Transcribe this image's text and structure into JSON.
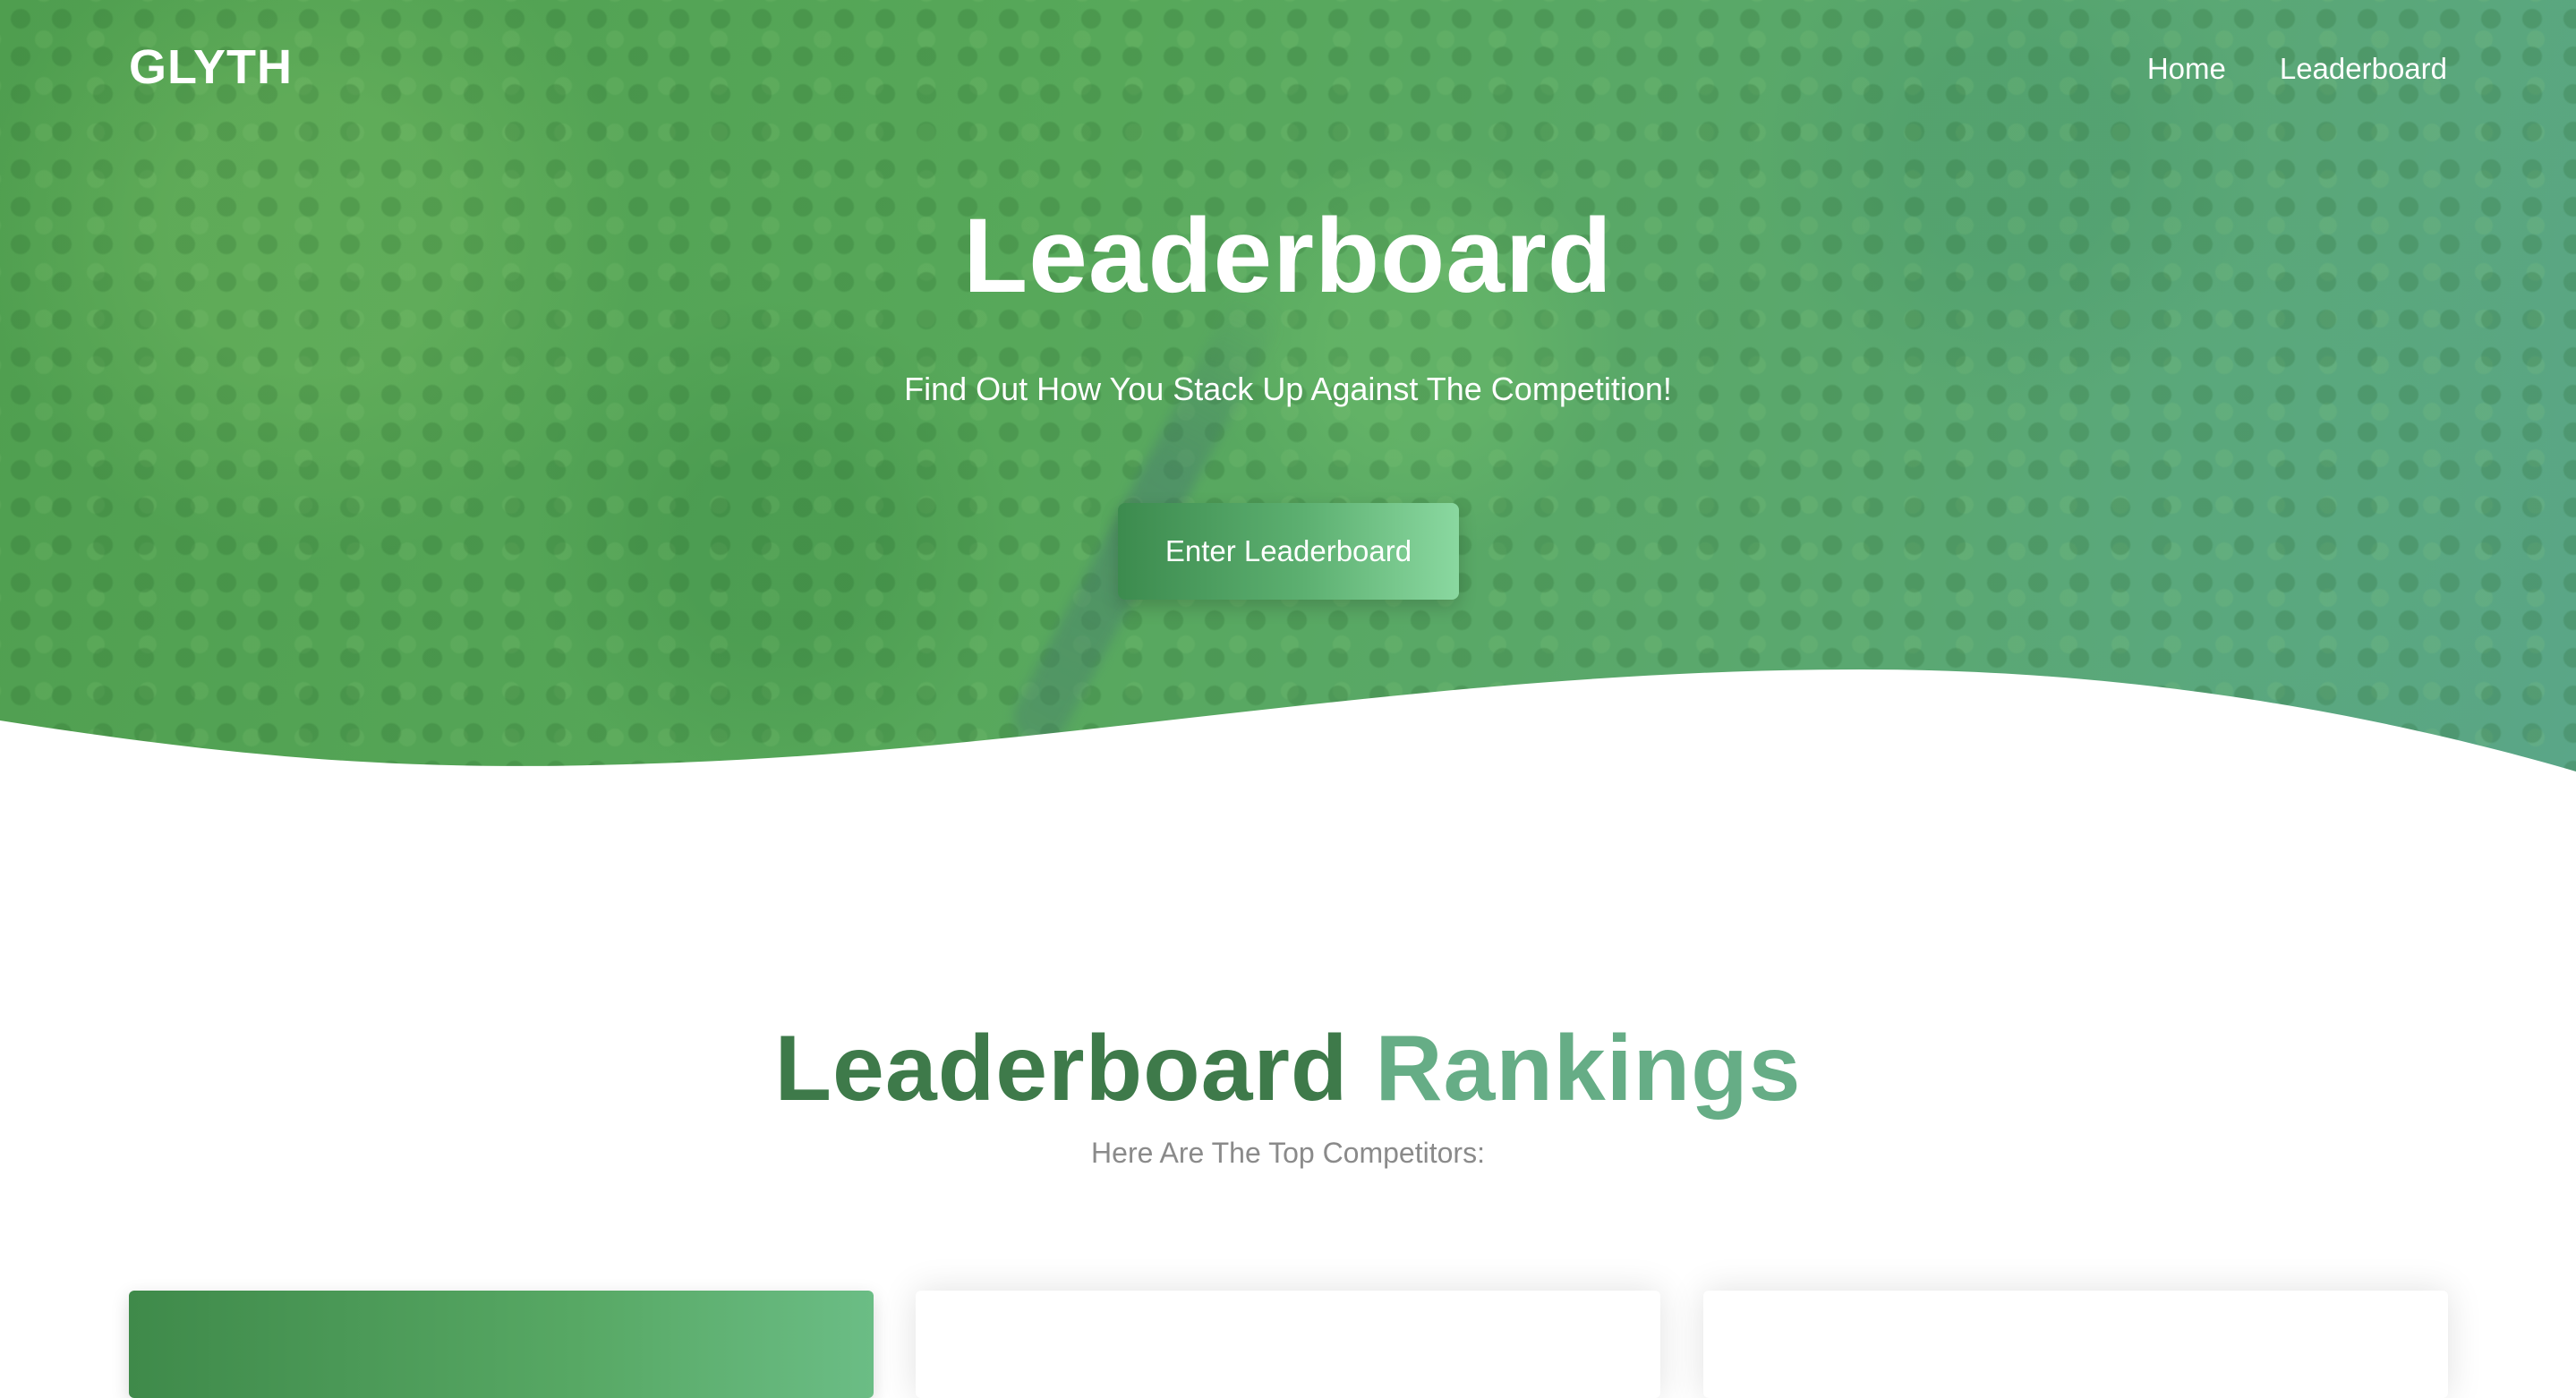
{
  "navbar": {
    "brand": "GLYTH",
    "links": [
      {
        "label": "Home"
      },
      {
        "label": "Leaderboard"
      }
    ]
  },
  "hero": {
    "title": "Leaderboard",
    "subtitle": "Find Out How You Stack Up Against The Competition!",
    "button_label": "Enter Leaderboard"
  },
  "rankings": {
    "title_part1": "Leaderboard",
    "title_part2": "Rankings",
    "subtitle": "Here Are The Top Competitors:"
  },
  "colors": {
    "hero_green": "#57a85a",
    "accent_dark": "#3e7a4a",
    "accent_light": "#66ad86",
    "subtitle_gray": "#8a8a8a"
  }
}
